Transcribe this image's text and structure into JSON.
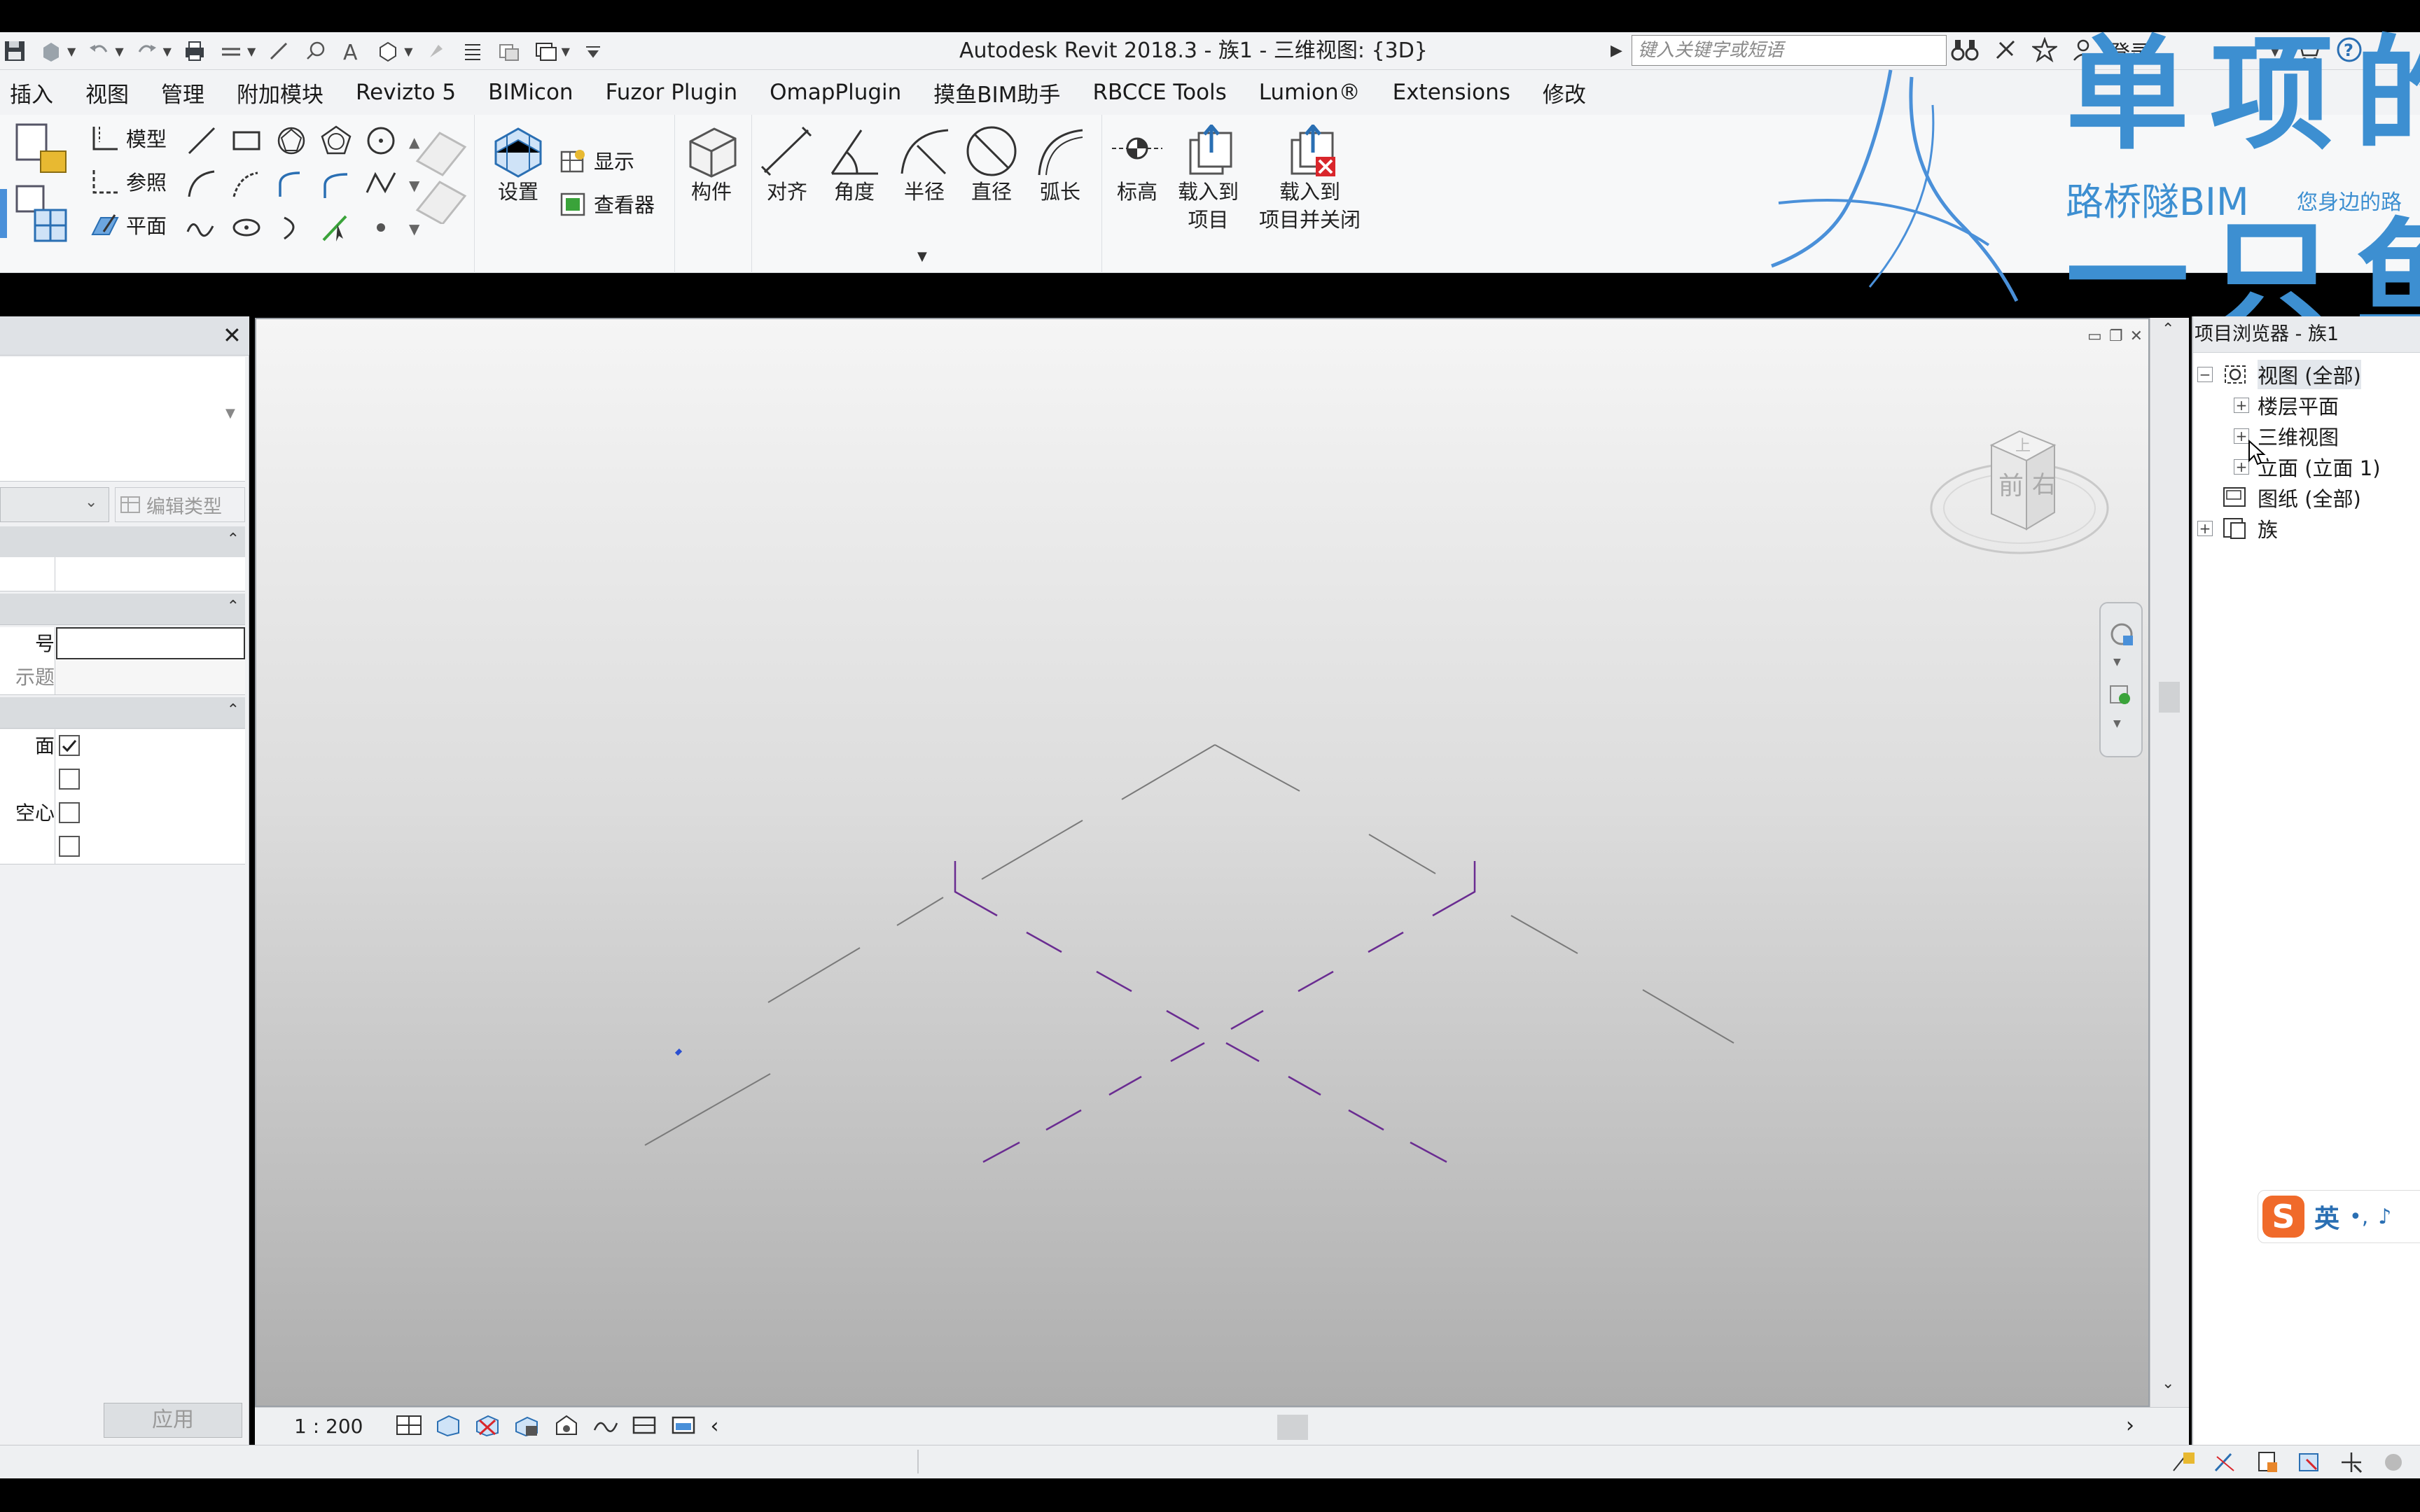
{
  "app": {
    "title": "Autodesk Revit 2018.3 -    族1 - 三维视图: {3D}",
    "search_placeholder": "键入关键字或短语",
    "login_label": "登录"
  },
  "menu": {
    "tabs": [
      "插入",
      "视图",
      "管理",
      "附加模块",
      "Revizto 5",
      "BIMicon",
      "Fuzor Plugin",
      "OmapPlugin",
      "摸鱼BIM助手",
      "RBCCE Tools",
      "Lumion®",
      "Extensions",
      "修改"
    ]
  },
  "ribbon": {
    "model_label": "模型",
    "ref_label": "参照",
    "plane_label": "平面",
    "settings_label": "设置",
    "show_label": "显示",
    "viewer_label": "查看器",
    "component_label": "构件",
    "align_label": "对齐",
    "angle_label": "角度",
    "radius_label": "半径",
    "diameter_label": "直径",
    "arc_label": "弧长",
    "level_label": "标高",
    "load_project_l1": "载入到",
    "load_project_l2": "项目",
    "load_close_l1": "载入到",
    "load_close_l2": "项目并关闭"
  },
  "watermark": {
    "line1": "单项的",
    "line2": "一只鱼",
    "brand": "路桥隧BIM",
    "slogan": "您身边的路"
  },
  "properties": {
    "edit_type_label": "编辑类型",
    "row_number_label": "号",
    "row_title_label": "示题",
    "row_a_label": "面",
    "row_void_label": "空心",
    "apply_label": "应用"
  },
  "viewport": {
    "scale": "1 : 200",
    "cube_top": "上",
    "cube_front": "前",
    "cube_right": "右"
  },
  "browser": {
    "header": "项目浏览器 - 族1",
    "tree": [
      {
        "label": "视图 (全部)",
        "level": 0,
        "sign": "−"
      },
      {
        "label": "楼层平面",
        "level": 1,
        "sign": "+"
      },
      {
        "label": "三维视图",
        "level": 1,
        "sign": "+"
      },
      {
        "label": "立面 (立面 1)",
        "level": 1,
        "sign": "+"
      },
      {
        "label": "图纸 (全部)",
        "level": 0,
        "sign": ""
      },
      {
        "label": "族",
        "level": 0,
        "sign": "+"
      }
    ]
  },
  "ime": {
    "badge": "S",
    "mode": "英"
  },
  "colors": {
    "accent_blue": "#3d8fd1",
    "line_purple": "#6a2c91",
    "line_gray": "#7a7a7a"
  }
}
